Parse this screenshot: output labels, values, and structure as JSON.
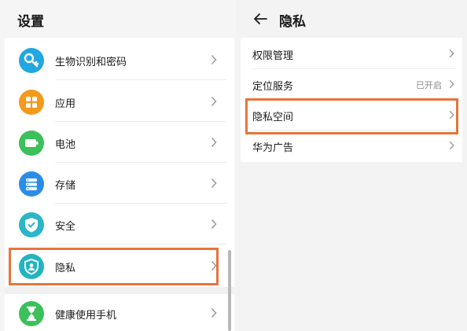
{
  "left": {
    "title": "设置",
    "items": [
      {
        "label": "生物识别和密码",
        "icon": "key-icon",
        "color": "#22a8e0"
      },
      {
        "label": "应用",
        "icon": "apps-grid-icon",
        "color": "#f39a1c"
      },
      {
        "label": "电池",
        "icon": "battery-icon",
        "color": "#3cc05a"
      },
      {
        "label": "存储",
        "icon": "storage-icon",
        "color": "#2a8ee8"
      },
      {
        "label": "安全",
        "icon": "shield-check-icon",
        "color": "#2ab6c8"
      },
      {
        "label": "隐私",
        "icon": "privacy-shield-icon",
        "color": "#22b4c0"
      },
      {
        "label": "健康使用手机",
        "icon": "hourglass-icon",
        "color": "#3cc05a"
      }
    ]
  },
  "right": {
    "title": "隐私",
    "items": [
      {
        "label": "权限管理",
        "value": ""
      },
      {
        "label": "定位服务",
        "value": "已开启"
      },
      {
        "label": "隐私空间",
        "value": ""
      },
      {
        "label": "华为广告",
        "value": ""
      }
    ]
  },
  "colors": {
    "highlight": "#e8743b",
    "background": "#f3f3f3",
    "card": "#ffffff"
  }
}
